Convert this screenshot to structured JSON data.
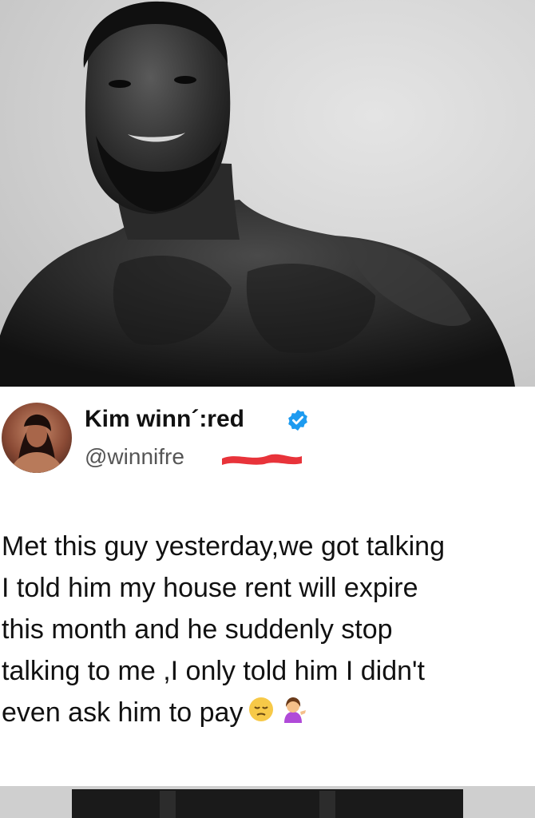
{
  "meme": {
    "background_color": "#cfcfcf",
    "subject": "muscular man portrait (black and white)"
  },
  "tweet": {
    "display_name": "Kim winn´:red",
    "handle": "@winnifre",
    "verified": true,
    "verified_color": "#1d9bf0",
    "redaction_color": "#e8333a",
    "body_lines": [
      "Met this guy yesterday,we got talking",
      "I told him my house rent will expire",
      "this month and he suddenly stop",
      "talking to me ,I only told him I didn't",
      "even  ask him to pay"
    ],
    "emojis": [
      "pensive-face-emoji",
      "woman-tipping-hand-emoji"
    ]
  }
}
